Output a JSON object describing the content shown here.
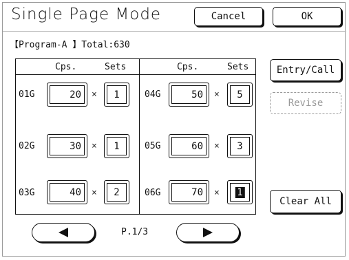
{
  "header": {
    "title": "Single Page Mode",
    "cancel_label": "Cancel",
    "ok_label": "OK"
  },
  "program": {
    "name_text": "【Program-A 】Total:630"
  },
  "table": {
    "left_headers": {
      "copies": "Cps.",
      "sets": "Sets"
    },
    "right_headers": {
      "copies": "Cps.",
      "sets": "Sets"
    },
    "groups": [
      {
        "label": "01G",
        "copies": "20",
        "sets": "1"
      },
      {
        "label": "02G",
        "copies": "30",
        "sets": "1"
      },
      {
        "label": "03G",
        "copies": "40",
        "sets": "2"
      },
      {
        "label": "04G",
        "copies": "50",
        "sets": "5"
      },
      {
        "label": "05G",
        "copies": "60",
        "sets": "3"
      },
      {
        "label": "06G",
        "copies": "70",
        "sets": "1"
      }
    ],
    "times_symbol": "×"
  },
  "side": {
    "entry_label": "Entry/Call",
    "revise_label": "Revise",
    "clear_all_label": "Clear All"
  },
  "pager": {
    "page_text": "P.1/3",
    "prev_icon": "left-triangle-icon",
    "next_icon": "right-triangle-icon"
  }
}
